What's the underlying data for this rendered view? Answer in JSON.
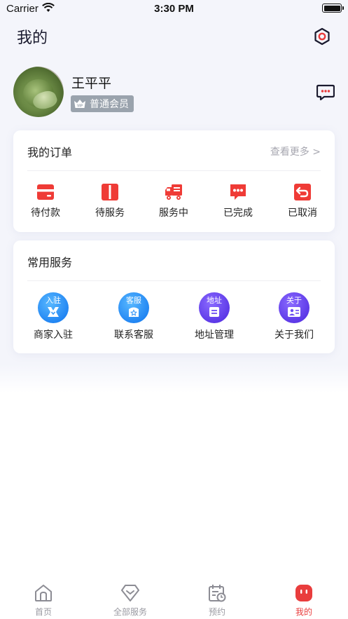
{
  "status_bar": {
    "carrier": "Carrier",
    "time": "3:30 PM"
  },
  "header": {
    "title": "我的"
  },
  "profile": {
    "name": "王平平",
    "member_level": "普通会员"
  },
  "orders": {
    "title": "我的订单",
    "see_more": "查看更多 >",
    "items": [
      {
        "label": "待付款",
        "icon": "card-icon"
      },
      {
        "label": "待服务",
        "icon": "service-icon"
      },
      {
        "label": "服务中",
        "icon": "truck-icon"
      },
      {
        "label": "已完成",
        "icon": "chat-dots-icon"
      },
      {
        "label": "已取消",
        "icon": "undo-icon"
      }
    ]
  },
  "services": {
    "title": "常用服务",
    "items": [
      {
        "label": "商家入驻",
        "icon_text": "入驻",
        "icon": "merchant-icon"
      },
      {
        "label": "联系客服",
        "icon_text": "客服",
        "icon": "customer-service-icon"
      },
      {
        "label": "地址管理",
        "icon_text": "地址",
        "icon": "address-icon"
      },
      {
        "label": "关于我们",
        "icon_text": "关于",
        "icon": "about-icon"
      }
    ]
  },
  "tab_bar": {
    "items": [
      {
        "label": "首页",
        "icon": "home-icon"
      },
      {
        "label": "全部服务",
        "icon": "diamond-icon"
      },
      {
        "label": "预约",
        "icon": "calendar-icon"
      },
      {
        "label": "我的",
        "icon": "profile-icon",
        "active": true
      }
    ]
  },
  "colors": {
    "accent_red": "#e93d3d",
    "badge_gray": "#9aa3ad",
    "navy": "#1a1a2e"
  }
}
